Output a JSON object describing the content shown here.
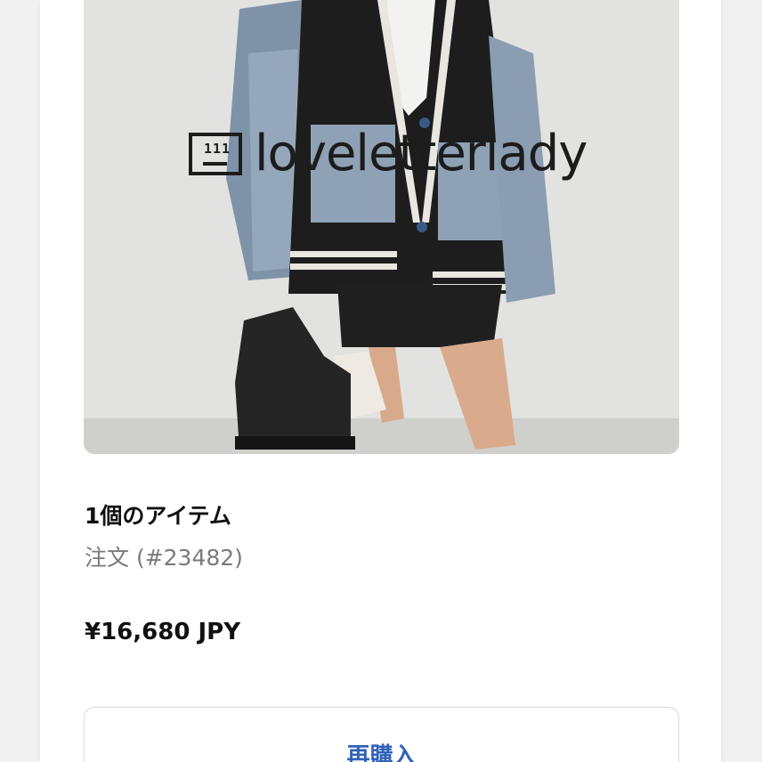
{
  "product": {
    "image_alt": "loveletterlady product photo",
    "brand_logo_text": "loveletterlady",
    "brand_logo_mark": "111"
  },
  "order": {
    "item_count": "1個のアイテム",
    "order_number": "注文 (#23482)",
    "total": "¥16,680 JPY"
  },
  "actions": {
    "rebuy_label": "再購入"
  },
  "colors": {
    "accent": "#2f62b8",
    "muted_text": "#7a7a7a",
    "page_bg": "#f1f1f1"
  }
}
